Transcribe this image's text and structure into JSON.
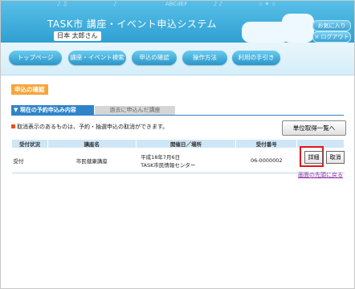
{
  "header": {
    "title": "TASK市  講座・イベント申込システム",
    "user_name": "日本 太郎さん",
    "deco_text": "ABCdEF",
    "buttons": {
      "help": "お気に入り",
      "logout": "× ログアウト"
    }
  },
  "nav": {
    "items": [
      {
        "label": "トップページ"
      },
      {
        "label": "講座・イベント検索"
      },
      {
        "label": "申込の確認"
      },
      {
        "label": "操作方法"
      },
      {
        "label": "利用の手引き"
      }
    ]
  },
  "page": {
    "section_title": "申込の確認",
    "tabs": {
      "active": "▼ 現在の予約申込み内容",
      "inactive": "過去に申込んだ講座"
    },
    "notice": "取消表示のあるものは、予約・抽選申込の取消ができます。",
    "list_button": "単位取得一覧へ",
    "table": {
      "headers": [
        "受付状況",
        "講座名",
        "開催日／場所",
        "受付番号"
      ],
      "rows": [
        {
          "status": "受付",
          "course": "市民健康講座",
          "date": "平成18年7月6日",
          "place": "TASK市民情報センター",
          "number": "06-0000002",
          "detail": "詳細",
          "cancel": "取消"
        }
      ]
    },
    "back_to_top": "画面の先頭に戻る"
  },
  "colors": {
    "header": "#3aa7d8",
    "accent": "#f6a53c",
    "tab": "#2f84c9",
    "highlight": "#e0161b"
  }
}
